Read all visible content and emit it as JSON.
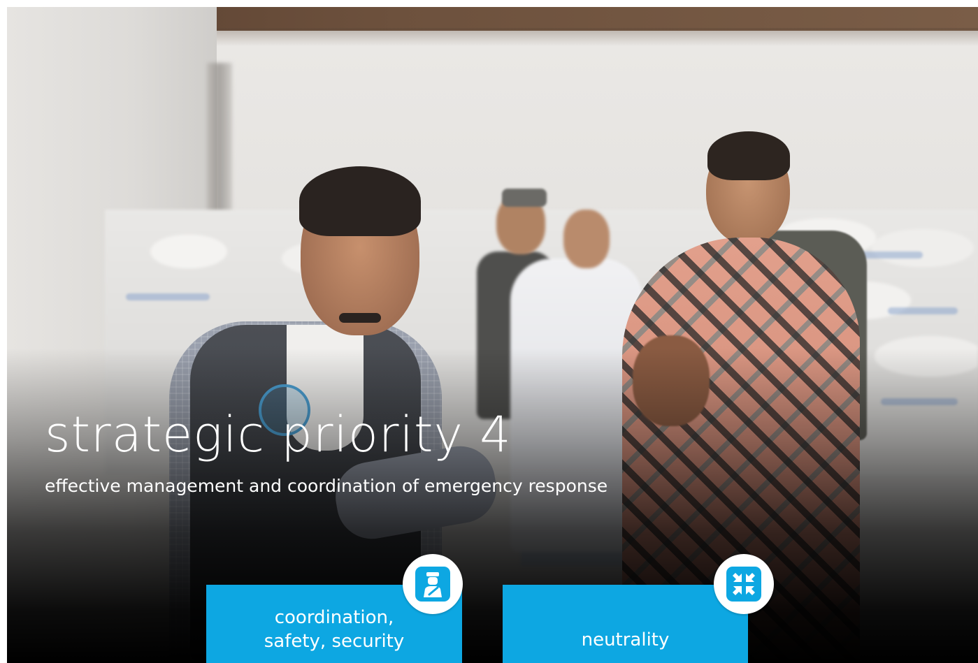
{
  "hero": {
    "title": "strategic priority 4",
    "subtitle": "effective management and coordination of emergency response"
  },
  "tiles": [
    {
      "lines": [
        "coordination,",
        "safety, security"
      ],
      "icon": "security-guard-icon"
    },
    {
      "lines": [
        "neutrality"
      ],
      "icon": "arrows-converge-icon"
    }
  ],
  "colors": {
    "accent": "#0da7e2",
    "text": "#ffffff",
    "background": "#000000"
  }
}
